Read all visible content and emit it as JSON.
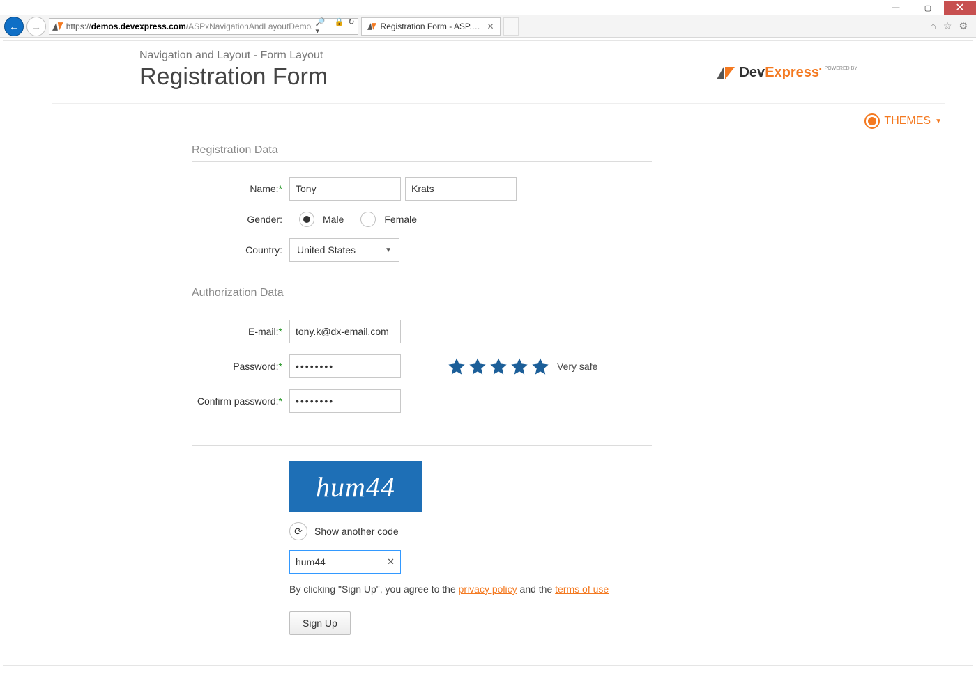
{
  "browser": {
    "url_prefix": "https://",
    "url_domain": "demos.devexpress.com",
    "url_path": "/ASPxNavigationAndLayoutDemos/",
    "tab_title": "Registration Form - ASP.NE..."
  },
  "header": {
    "breadcrumb": "Navigation and Layout - Form Layout",
    "title": "Registration Form",
    "themes_label": "THEMES",
    "logo_powered": "POWERED BY",
    "logo_dev": "Dev",
    "logo_express": "Express"
  },
  "form": {
    "section_reg": "Registration Data",
    "section_auth": "Authorization Data",
    "labels": {
      "name": "Name:",
      "gender": "Gender:",
      "country": "Country:",
      "email": "E-mail:",
      "password": "Password:",
      "confirm": "Confirm password:"
    },
    "values": {
      "first_name": "Tony",
      "last_name": "Krats",
      "gender_male": "Male",
      "gender_female": "Female",
      "country": "United States",
      "email": "tony.k@dx-email.com",
      "password": "••••••••",
      "confirm": "••••••••",
      "rating_text": "Very safe"
    },
    "captcha": {
      "image_text": "hum44",
      "show_another": "Show another code",
      "input_value": "hum44"
    },
    "agree_prefix": "By clicking \"Sign Up\", you agree to the ",
    "agree_privacy": "privacy policy",
    "agree_mid": " and the ",
    "agree_terms": "terms of use",
    "signup": "Sign Up"
  }
}
